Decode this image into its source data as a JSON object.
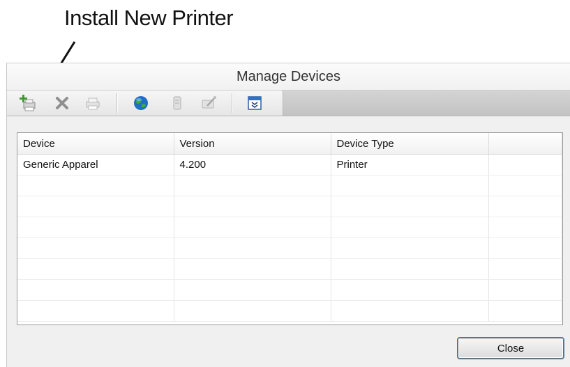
{
  "annotation": {
    "label": "Install New Printer"
  },
  "window": {
    "title": "Manage Devices"
  },
  "toolbar": {
    "buttons": [
      {
        "icon": "add-printer-icon",
        "enabled": true
      },
      {
        "icon": "delete-icon",
        "enabled": false
      },
      {
        "icon": "printer-icon",
        "enabled": false
      },
      {
        "icon": "globe-icon",
        "enabled": true
      },
      {
        "icon": "device-icon",
        "enabled": false
      },
      {
        "icon": "configure-icon",
        "enabled": false
      },
      {
        "icon": "expand-panel-icon",
        "enabled": true
      }
    ]
  },
  "grid": {
    "columns": [
      "Device",
      "Version",
      "Device Type",
      ""
    ],
    "rows": [
      [
        "Generic Apparel",
        "4.200",
        "Printer",
        ""
      ],
      [
        "",
        "",
        "",
        ""
      ],
      [
        "",
        "",
        "",
        ""
      ],
      [
        "",
        "",
        "",
        ""
      ],
      [
        "",
        "",
        "",
        ""
      ],
      [
        "",
        "",
        "",
        ""
      ],
      [
        "",
        "",
        "",
        ""
      ],
      [
        "",
        "",
        "",
        ""
      ]
    ]
  },
  "footer": {
    "close_label": "Close"
  }
}
